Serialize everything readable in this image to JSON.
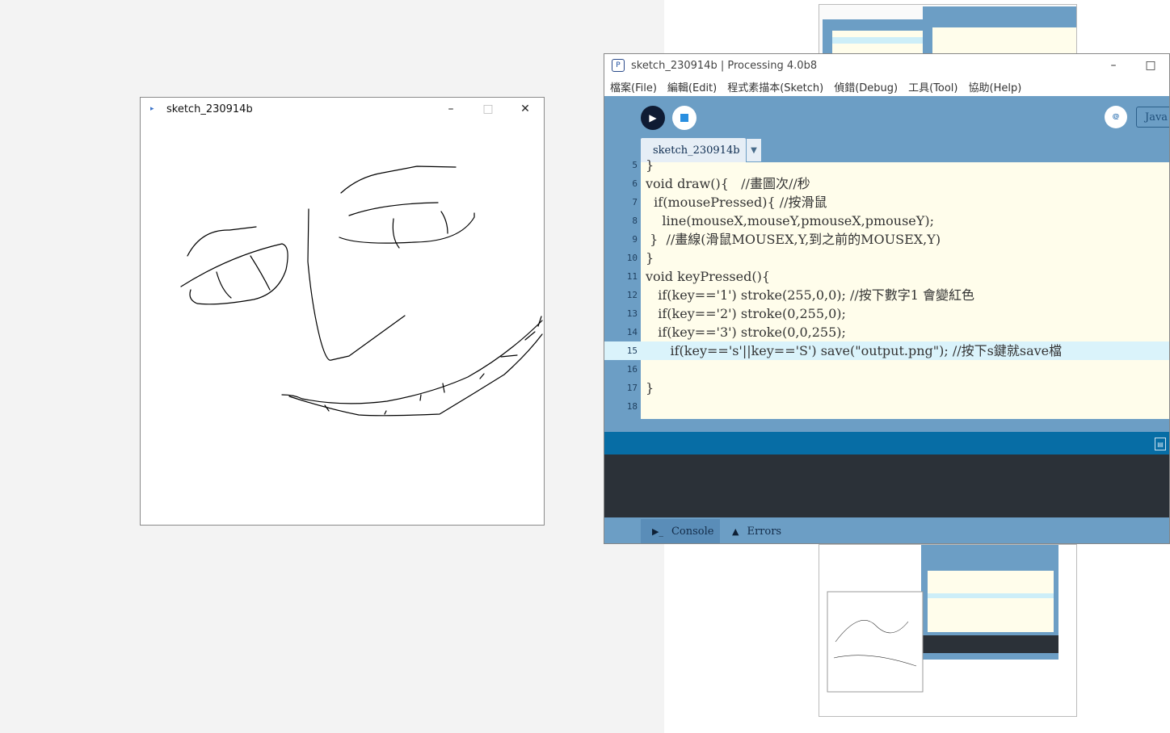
{
  "sketch_window": {
    "title": "sketch_230914b",
    "minimize": "–",
    "maximize": "□",
    "close": "✕"
  },
  "ide": {
    "title": "sketch_230914b | Processing 4.0b8",
    "minimize": "–",
    "maximize": "□",
    "menu": [
      "檔案(File)",
      "編輯(Edit)",
      "程式素描本(Sketch)",
      "偵錯(Debug)",
      "工具(Tool)",
      "協助(Help)"
    ],
    "mode": "Java",
    "tab_name": "sketch_230914b",
    "tab_arrow": "▼",
    "code": [
      {
        "n": "5",
        "text": "}"
      },
      {
        "n": "6",
        "text": "void draw(){   //畫圖次//秒"
      },
      {
        "n": "7",
        "text": "  if(mousePressed){ //按滑鼠"
      },
      {
        "n": "8",
        "text": "    line(mouseX,mouseY,pmouseX,pmouseY);"
      },
      {
        "n": "9",
        "text": " }  //畫線(滑鼠MOUSEX,Y,到之前的MOUSEX,Y)"
      },
      {
        "n": "10",
        "text": "}"
      },
      {
        "n": "11",
        "text": "void keyPressed(){"
      },
      {
        "n": "12",
        "text": "   if(key=='1') stroke(255,0,0); //按下數字1 會變紅色"
      },
      {
        "n": "13",
        "text": "   if(key=='2') stroke(0,255,0);"
      },
      {
        "n": "14",
        "text": "   if(key=='3') stroke(0,0,255);"
      },
      {
        "n": "15",
        "text": "      if(key=='s'||key=='S') save(\"output.png\"); //按下s鍵就save檔"
      },
      {
        "n": "16",
        "text": ""
      },
      {
        "n": "17",
        "text": "}"
      },
      {
        "n": "18",
        "text": ""
      }
    ],
    "console_tab": "Console",
    "errors_tab": "Errors"
  },
  "colors": {
    "ide_blue": "#6c9ec5",
    "editor_bg": "#fffdeb",
    "status_bar": "#076da5",
    "console_bg": "#2b3138",
    "highlight_line": "#daf3fb"
  }
}
